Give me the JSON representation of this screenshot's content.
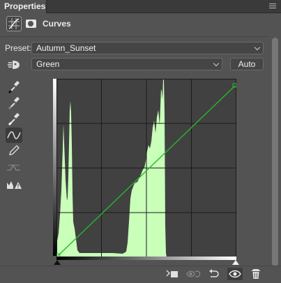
{
  "panel": {
    "tab_label": "Properties",
    "adjustment_label": "Curves"
  },
  "preset": {
    "label": "Preset:",
    "value": "Autumn_Sunset"
  },
  "channel": {
    "value": "Green"
  },
  "auto_button": {
    "label": "Auto"
  },
  "tools": [
    {
      "icon": "hand-target-icon"
    },
    {
      "icon": "black-point-eyedropper-icon"
    },
    {
      "icon": "gray-point-eyedropper-icon"
    },
    {
      "icon": "white-point-eyedropper-icon"
    },
    {
      "icon": "curve-points-icon",
      "selected": true
    },
    {
      "icon": "pencil-icon"
    },
    {
      "icon": "smooth-curve-icon"
    },
    {
      "icon": "clipping-warning-icon"
    }
  ],
  "curve": {
    "channel_color": "#22c02a",
    "histogram_color": "#c9ffb9",
    "points_input_output": [
      [
        0,
        0
      ],
      [
        255,
        255
      ]
    ]
  },
  "bottom_bar": [
    {
      "icon": "clip-to-layer-icon"
    },
    {
      "icon": "view-previous-state-icon"
    },
    {
      "icon": "reset-icon"
    },
    {
      "icon": "visibility-eye-icon",
      "active": true
    },
    {
      "icon": "trash-icon"
    }
  ]
}
